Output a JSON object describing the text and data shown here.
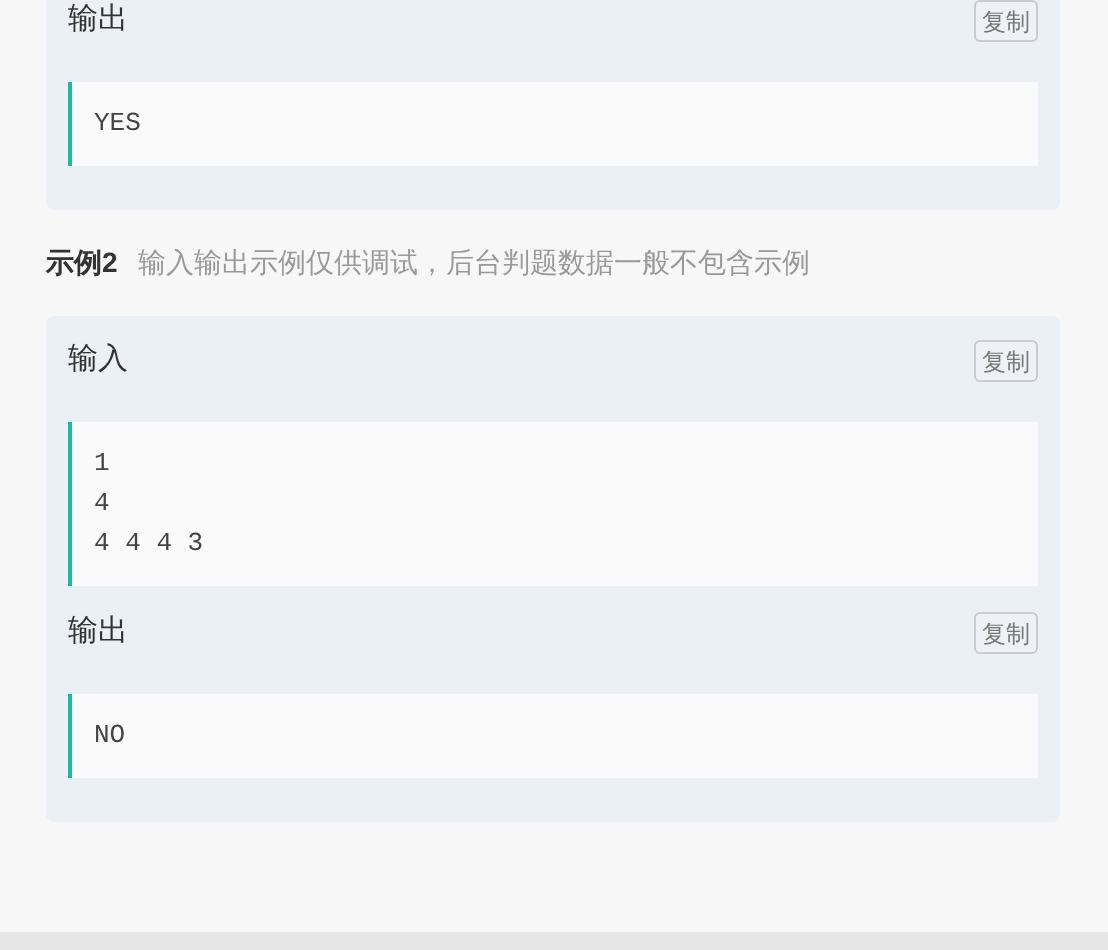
{
  "examples": [
    {
      "sections": [
        {
          "label": "输出",
          "copy_button": "复制",
          "code": "YES"
        }
      ]
    },
    {
      "title": "示例2",
      "note": "输入输出示例仅供调试，后台判题数据一般不包含示例",
      "sections": [
        {
          "label": "输入",
          "copy_button": "复制",
          "code": "1\n4\n4 4 4 3"
        },
        {
          "label": "输出",
          "copy_button": "复制",
          "code": "NO"
        }
      ]
    }
  ]
}
